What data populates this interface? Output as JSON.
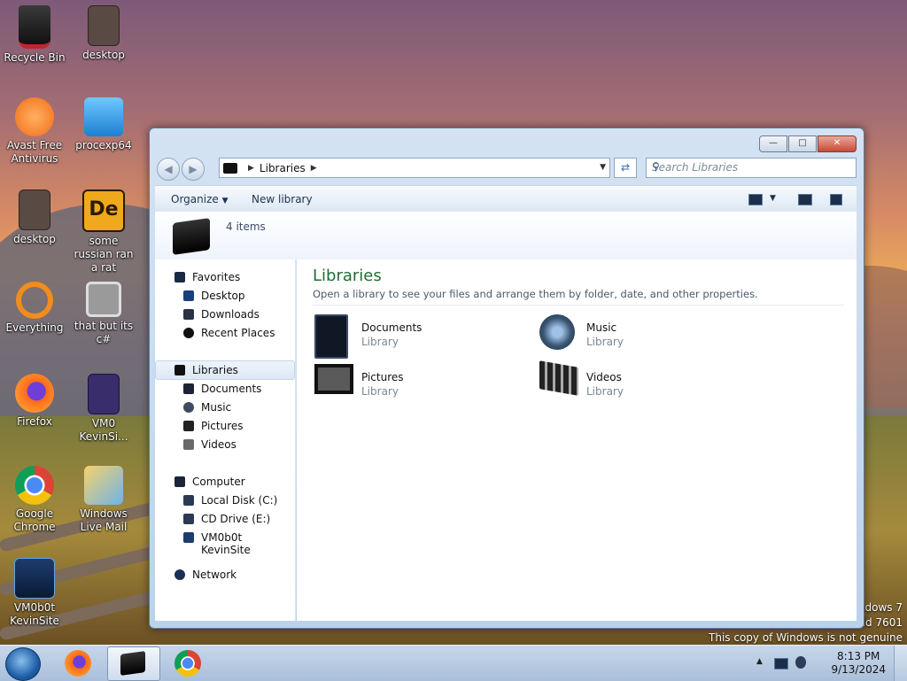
{
  "desktop": {
    "icons": [
      {
        "label": "Recycle Bin",
        "icon": "recycle-bin-icon"
      },
      {
        "label": "desktop",
        "icon": "document-icon"
      },
      {
        "label": "Avast Free Antivirus",
        "icon": "avast-icon"
      },
      {
        "label": "procexp64",
        "icon": "procexp-icon"
      },
      {
        "label": "desktop",
        "icon": "document-icon"
      },
      {
        "label": "some russian ran a rat",
        "icon": "de-icon"
      },
      {
        "label": "Everything",
        "icon": "magnifier-icon"
      },
      {
        "label": "that but its c#",
        "icon": "windows-stack-icon"
      },
      {
        "label": "Firefox",
        "icon": "firefox-icon"
      },
      {
        "label": "VM0 KevinSi...",
        "icon": "firefox-file-icon"
      },
      {
        "label": "Google Chrome",
        "icon": "chrome-icon"
      },
      {
        "label": "Windows Live Mail",
        "icon": "mail-icon"
      },
      {
        "label": "VM0b0t KevinSite",
        "icon": "vm-icon"
      }
    ],
    "watermark": {
      "line1": "Windows 7",
      "line2": "Build 7601",
      "line3": "This copy of Windows is not genuine"
    }
  },
  "window": {
    "address": {
      "path_label": "Libraries"
    },
    "search_placeholder": "Search Libraries",
    "toolbar": {
      "organize": "Organize",
      "new_library": "New library"
    },
    "details": {
      "item_count": "4 items"
    },
    "nav": {
      "favorites": "Favorites",
      "desktop": "Desktop",
      "downloads": "Downloads",
      "recent_places": "Recent Places",
      "libraries": "Libraries",
      "documents": "Documents",
      "music": "Music",
      "pictures": "Pictures",
      "videos": "Videos",
      "computer": "Computer",
      "local_disk": "Local Disk (C:)",
      "cd_drive": "CD Drive (E:)",
      "vm_site": "VM0b0t KevinSite",
      "network": "Network"
    },
    "content": {
      "title": "Libraries",
      "subtitle": "Open a library to see your files and arrange them by folder, date, and other properties.",
      "libraries": [
        {
          "name": "Documents",
          "type": "Library"
        },
        {
          "name": "Music",
          "type": "Library"
        },
        {
          "name": "Pictures",
          "type": "Library"
        },
        {
          "name": "Videos",
          "type": "Library"
        }
      ]
    }
  },
  "taskbar": {
    "time": "8:13 PM",
    "date": "9/13/2024"
  },
  "colors": {
    "title_green": "#1f6d33",
    "accent": "#3a6fb5"
  }
}
